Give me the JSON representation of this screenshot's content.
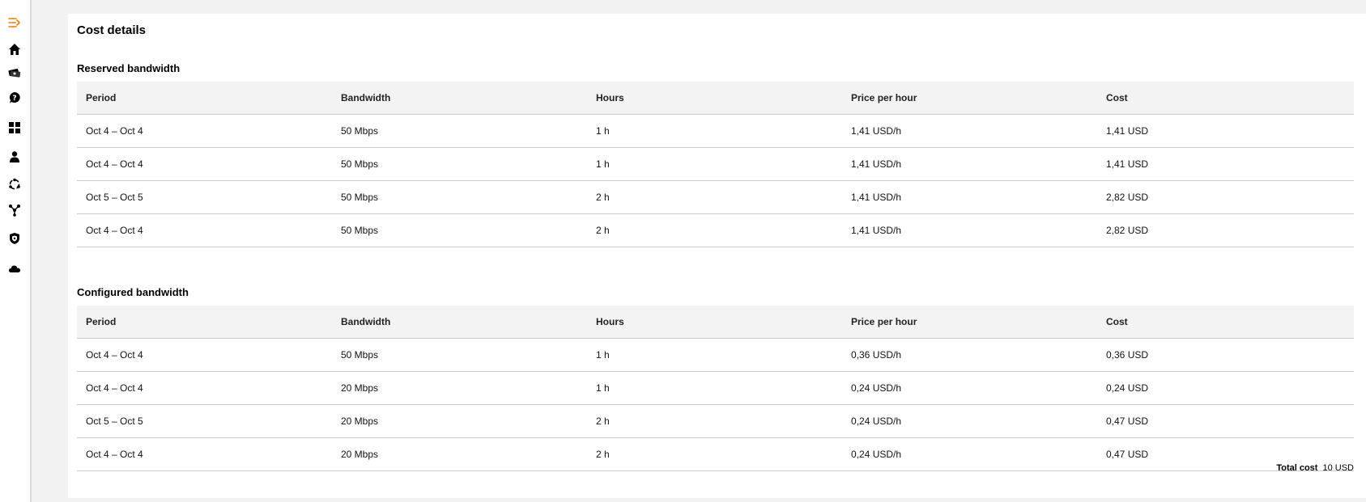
{
  "sidebar": {
    "icons": [
      "collapse-menu-icon",
      "home-icon",
      "tickets-icon",
      "help-icon",
      "dashboard-icon",
      "user-icon",
      "network-icon",
      "topology-icon",
      "security-icon",
      "cloud-icon"
    ],
    "accent": "#ff7900"
  },
  "card": {
    "title": "Cost details"
  },
  "reserved": {
    "title": "Reserved bandwidth",
    "headers": [
      "Period",
      "Bandwidth",
      "Hours",
      "Price per hour",
      "Cost"
    ],
    "rows": [
      [
        "Oct 4 – Oct 4",
        "50 Mbps",
        "1 h",
        "1,41 USD/h",
        "1,41 USD"
      ],
      [
        "Oct 4 – Oct 4",
        "50 Mbps",
        "1 h",
        "1,41 USD/h",
        "1,41 USD"
      ],
      [
        "Oct 5 – Oct 5",
        "50 Mbps",
        "2 h",
        "1,41 USD/h",
        "2,82 USD"
      ],
      [
        "Oct 4 – Oct 4",
        "50 Mbps",
        "2 h",
        "1,41 USD/h",
        "2,82 USD"
      ]
    ]
  },
  "configured": {
    "title": "Configured bandwidth",
    "headers": [
      "Period",
      "Bandwidth",
      "Hours",
      "Price per hour",
      "Cost"
    ],
    "rows": [
      [
        "Oct 4 – Oct 4",
        "50 Mbps",
        "1 h",
        "0,36 USD/h",
        "0,36 USD"
      ],
      [
        "Oct 4 – Oct 4",
        "20 Mbps",
        "1 h",
        "0,24 USD/h",
        "0,24 USD"
      ],
      [
        "Oct 5 – Oct 5",
        "20 Mbps",
        "2 h",
        "0,24 USD/h",
        "0,47 USD"
      ],
      [
        "Oct 4 – Oct 4",
        "20 Mbps",
        "2 h",
        "0,24 USD/h",
        "0,47 USD"
      ]
    ]
  },
  "total": {
    "label": "Total cost",
    "value": "10 USD"
  }
}
